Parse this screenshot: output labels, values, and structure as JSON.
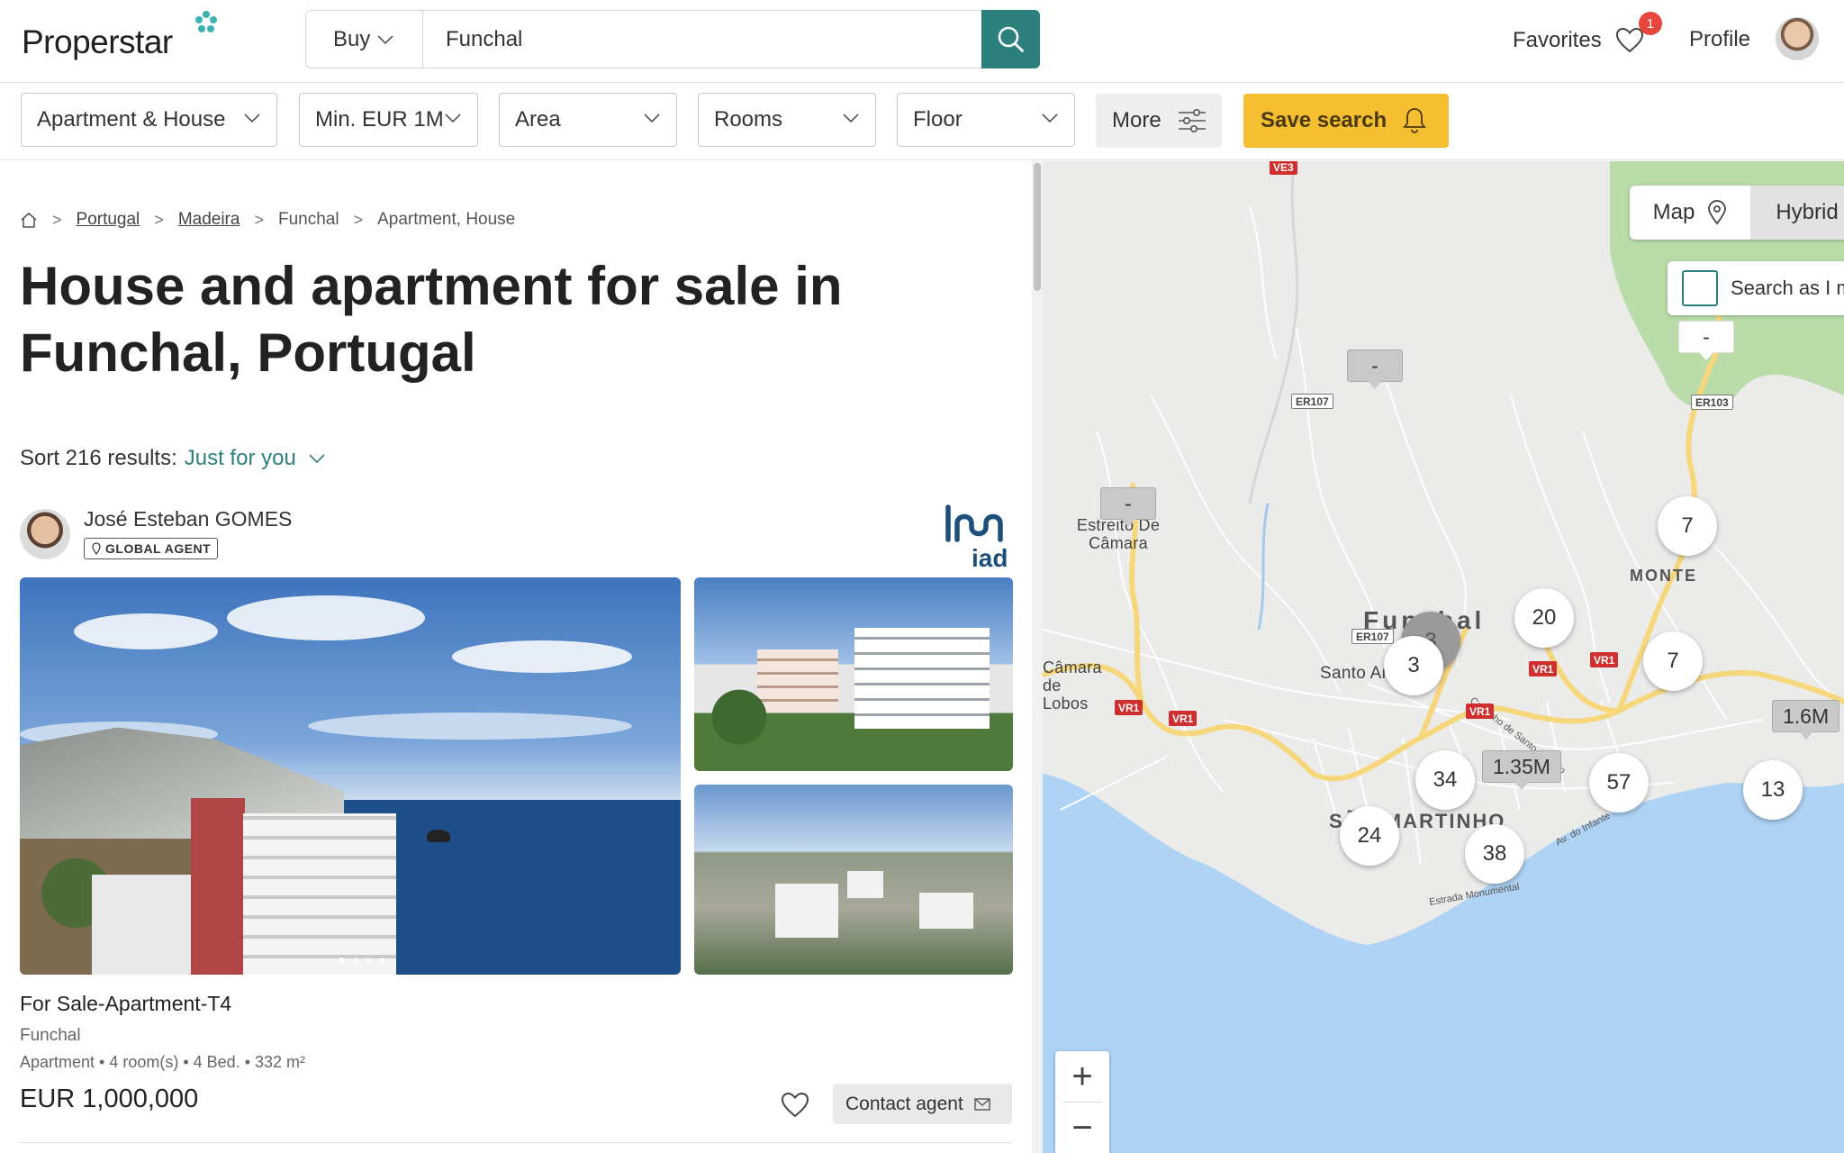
{
  "header": {
    "logo_text": "Properstar",
    "transaction_select": "Buy",
    "search_value": "Funchal",
    "favorites_label": "Favorites",
    "favorites_count": "1",
    "profile_label": "Profile"
  },
  "filters": {
    "property_type": "Apartment & House",
    "price": "Min. EUR 1M",
    "area": "Area",
    "rooms": "Rooms",
    "floor": "Floor",
    "more": "More",
    "save_search": "Save search"
  },
  "breadcrumb": {
    "items": [
      "Portugal",
      "Madeira",
      "Funchal",
      "Apartment, House"
    ]
  },
  "page_title": "House and apartment for sale in Funchal, Portugal",
  "sort": {
    "label": "Sort 216 results:",
    "value": "Just for you"
  },
  "listing": {
    "agent_name": "José Esteban GOMES",
    "agent_tag": "GLOBAL AGENT",
    "agency_logo_text": "iad",
    "title": "For Sale-Apartment-T4",
    "location": "Funchal",
    "meta": "Apartment • 4 room(s) • 4 Bed. • 332 m²",
    "price": "EUR 1,000,000",
    "contact_label": "Contact agent"
  },
  "map": {
    "toggle": [
      "Map",
      "Hybrid"
    ],
    "active_mode": "Hybrid",
    "search_as_label": "Search as I move the map",
    "clusters": [
      "7",
      "20",
      "3",
      "3",
      "7",
      "34",
      "57",
      "13",
      "24",
      "38"
    ],
    "price_pins": [
      "1.35M",
      "1.6M",
      "-",
      "-",
      "-"
    ],
    "labels": [
      "Estreito De Câmara",
      "MONTE",
      "Funchal",
      "Santo António",
      "SÃO MARTINHO",
      "Câmara de Lobos"
    ],
    "road_tags": [
      "ER107",
      "ER107",
      "ER103",
      "VR1",
      "VR1",
      "VR1",
      "VR1",
      "VR1",
      "ER107"
    ],
    "street_names": [
      "Caminho de Santo António",
      "Av. do Infante",
      "Estrada Monumental"
    ],
    "zoom_in": "+",
    "zoom_out": "−"
  },
  "colors": {
    "brand_teal": "#2b7f7c",
    "save_yellow": "#f6bf32",
    "badge_red": "#e8453c",
    "sea": "#aed3f5",
    "road_yellow": "#f7d77c"
  }
}
